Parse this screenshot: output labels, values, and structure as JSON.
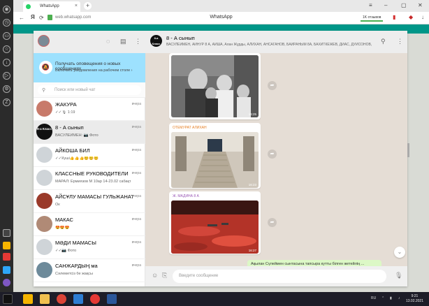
{
  "browser": {
    "tab_title": "WhatsApp",
    "url": "web.whatsapp.com",
    "page_title": "WhatsApp",
    "reviews_badge": "1K отзывов",
    "yandex_label": "Я"
  },
  "whatsapp": {
    "notification": {
      "title": "Получать оповещения о новых сообщениях",
      "subtitle": "Включить уведомления на рабочем столе ›"
    },
    "search": {
      "placeholder": "Поиск или новый чат"
    },
    "chats": [
      {
        "name": "ЖАКУРА",
        "preview": "✓✓🎙 1:19",
        "time": "вчера",
        "avatar_color": "#c87a6a"
      },
      {
        "name": "8 - А сынып",
        "preview": "ВАСУЛЕЙМЕН: 📷 Фото",
        "time": "вчера",
        "avatar_color": "#111111",
        "avatar_text": "8-а Класс",
        "active": true
      },
      {
        "name": "АЙКОША БИЛ",
        "preview": "✓✓Күші👍👍👍😊😊😊",
        "time": "вчера",
        "avatar_color": "#cfd4d8"
      },
      {
        "name": "КЛАССНЫЕ  РУКОВОДИТЕЛИ",
        "preview": "МАРАЛ: Ермиязов М 10ар 14-23.02 сабақта бо...",
        "time": "вчера",
        "avatar_color": "#cfd4d8"
      },
      {
        "name": "АЙСҰЛУ МАМАСЫ ГУЛЬЖАНАТ",
        "preview": "Ок",
        "time": "вчера",
        "avatar_color": "#9a3a2a"
      },
      {
        "name": "МАКАС",
        "preview": "😍😍😍",
        "time": "вчера",
        "avatar_color": "#b08a76"
      },
      {
        "name": "МӘДИ МАМАСЫ",
        "preview": "✓✓📷 Фото",
        "time": "вчера",
        "avatar_color": "#cfd4d8"
      },
      {
        "name": "САНЖАРДЫҢ ма",
        "preview": "Сәлеметсіз бе жақсы",
        "time": "вчера",
        "avatar_color": "#6d8a9a"
      }
    ],
    "conversation": {
      "title": "8 - А сынып",
      "avatar_text": "8-а Класс",
      "participants": "ВАСУЛЕЙМЕН, АЙНУР 8 А, АЙША, Алан Жұрды, АЛИХАН, АНСАГАНОВ, БАЙРАНЫМ 8А, БАХИТКЕЖЕВ, ДИАС, ДУЙСОНОВ, ЕР...",
      "messages": [
        {
          "sender": "",
          "time": "16:25",
          "photo": "family"
        },
        {
          "sender": "ОТЕМУРАТ АЛИХАН",
          "sender_color": "#e67e22",
          "time": "16:23",
          "photo": "stairs"
        },
        {
          "sender": "Ж. МАДИНА 8 А",
          "sender_color": "#9b59b6",
          "time": "16:27",
          "photo": "field"
        }
      ],
      "outgoing_preview": "Ақылан Сүлеймен сынтасына тапсыра кутты білген жетейлің ...",
      "compose_placeholder": "Введите сообщение"
    }
  },
  "taskbar": {
    "lang": "RU",
    "time": "9:21",
    "date": "13.02.2021"
  }
}
